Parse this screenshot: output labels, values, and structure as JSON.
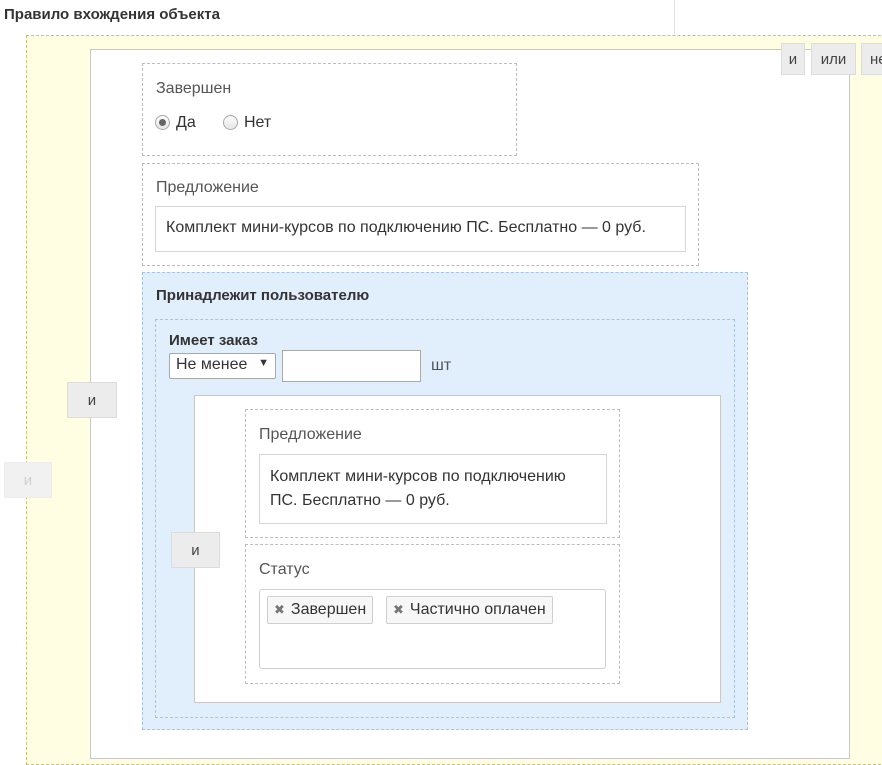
{
  "header": {
    "title": "Правило вхождения объекта"
  },
  "outer_group": {
    "op_button": "и"
  },
  "group1": {
    "op_button": "и",
    "top_buttons": [
      "и",
      "или",
      "не"
    ]
  },
  "completed": {
    "label": "Завершен",
    "options": [
      {
        "label": "Да",
        "checked": true
      },
      {
        "label": "Нет",
        "checked": false
      }
    ]
  },
  "offer1": {
    "label": "Предложение",
    "value": "Комплект мини-курсов по подключению ПС. Бесплатно — 0 руб."
  },
  "belongs_to_user": {
    "label": "Принадлежит пользователю",
    "has_order": {
      "label": "Имеет заказ",
      "comparator": "Не менее",
      "comparator_arrow": "▼",
      "quantity": "",
      "unit": "шт"
    },
    "inner_group": {
      "op_button": "и",
      "offer": {
        "label": "Предложение",
        "value_line1": "Комплект мини-курсов по подключению",
        "value_line2": "ПС. Бесплатно — 0 руб."
      },
      "status": {
        "label": "Статус",
        "remove_glyph": "✖",
        "tags": [
          "Завершен",
          "Частично оплачен"
        ]
      }
    }
  }
}
